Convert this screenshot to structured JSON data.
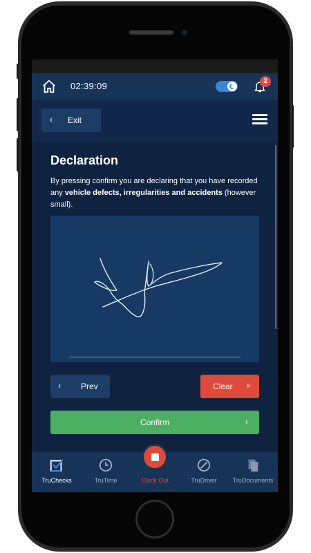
{
  "header": {
    "time": "02:39:09",
    "notification_count": "2"
  },
  "topbar": {
    "exit_label": "Exit"
  },
  "declaration": {
    "title": "Declaration",
    "text_before": "By pressing confirm you are declaring that you have recorded any ",
    "text_bold": "vehicle defects, irregularities and accidents",
    "text_after": " (however small)."
  },
  "actions": {
    "prev_label": "Prev",
    "clear_label": "Clear",
    "confirm_label": "Confirm"
  },
  "nav": {
    "items": [
      {
        "label": "TruChecks",
        "icon": "checkbox-icon",
        "active": true
      },
      {
        "label": "TruTime",
        "icon": "clock-icon",
        "active": false
      },
      {
        "label": "Clock Out",
        "icon": "stop-icon",
        "active": false
      },
      {
        "label": "TruDriver",
        "icon": "steering-icon",
        "active": false
      },
      {
        "label": "TruDocuments",
        "icon": "documents-icon",
        "active": false
      }
    ]
  },
  "colors": {
    "background": "#0f2240",
    "header": "#173358",
    "clear_red": "#e04a3a",
    "confirm_green": "#4caf63",
    "toggle_blue": "#3a86d8"
  }
}
